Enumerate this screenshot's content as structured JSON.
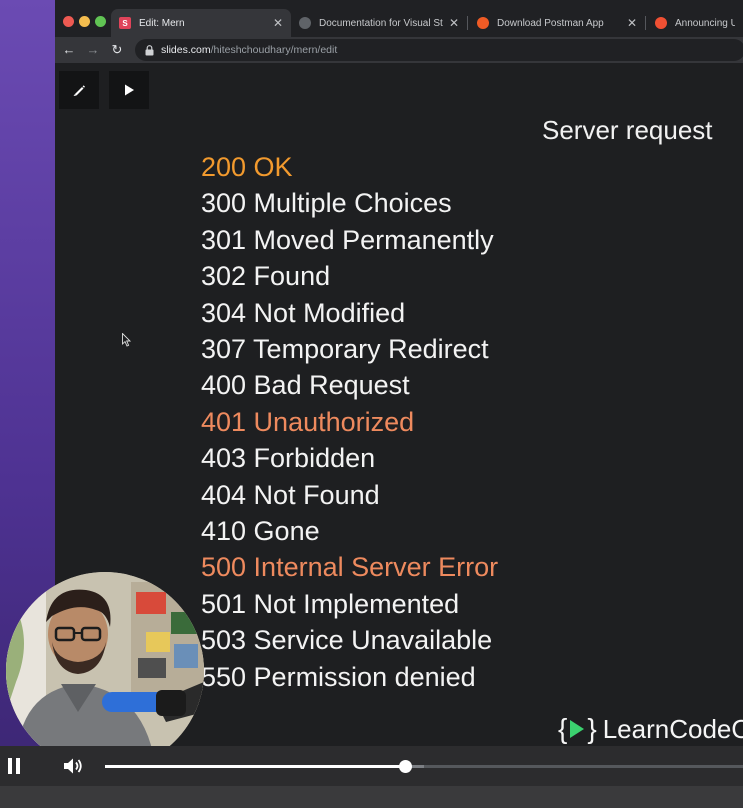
{
  "browser": {
    "tabs": [
      {
        "title": "Edit: Mern",
        "favicon": "slides-icon",
        "favicon_color": "#e0445a",
        "active": true
      },
      {
        "title": "Documentation for Visual Studio",
        "favicon": "globe-icon",
        "favicon_color": "#5f6368",
        "active": false
      },
      {
        "title": "Download Postman App",
        "favicon": "postman-icon",
        "favicon_color": "#ef5b25",
        "active": false
      },
      {
        "title": "Announcing Updat",
        "favicon": "compass-icon",
        "favicon_color": "#f05033",
        "active": false
      }
    ],
    "address": {
      "domain": "slides.com",
      "path": "/hiteshchoudhary/mern/edit"
    }
  },
  "slide": {
    "title": "Server request",
    "status_codes": [
      {
        "text": "200 OK",
        "color": "#f29a2e"
      },
      {
        "text": "300 Multiple Choices",
        "color": "#f3f3f3"
      },
      {
        "text": "301 Moved Permanently",
        "color": "#f3f3f3"
      },
      {
        "text": "302 Found",
        "color": "#f3f3f3"
      },
      {
        "text": "304 Not Modified",
        "color": "#f3f3f3"
      },
      {
        "text": "307 Temporary Redirect",
        "color": "#f3f3f3"
      },
      {
        "text": "400 Bad Request",
        "color": "#f3f3f3"
      },
      {
        "text": "401 Unauthorized",
        "color": "#ee8a5e"
      },
      {
        "text": "403 Forbidden",
        "color": "#f3f3f3"
      },
      {
        "text": "404 Not Found",
        "color": "#f3f3f3"
      },
      {
        "text": "410 Gone",
        "color": "#f3f3f3"
      },
      {
        "text": "500 Internal Server Error",
        "color": "#ee8a5e"
      },
      {
        "text": "501 Not Implemented",
        "color": "#f3f3f3"
      },
      {
        "text": "503 Service Unavailable",
        "color": "#f3f3f3"
      },
      {
        "text": "550 Permission denied",
        "color": "#f3f3f3"
      }
    ],
    "brand": "LearnCodeO"
  },
  "player": {
    "progress_fraction": 0.47,
    "buffered_fraction": 0.5,
    "accent": "#ffffff"
  }
}
